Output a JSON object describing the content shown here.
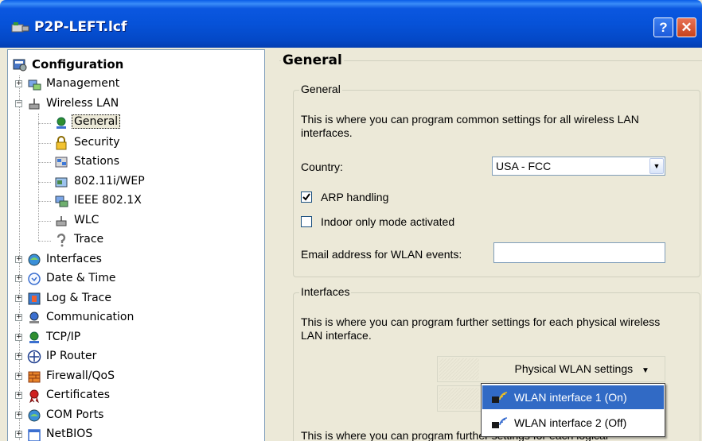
{
  "window": {
    "title": "P2P-LEFT.lcf",
    "help_label": "?",
    "close_label": "✕"
  },
  "tree": {
    "root": {
      "label": "Configuration",
      "icon": "configuration-icon"
    },
    "items": [
      {
        "label": "Management",
        "icon": "management-icon",
        "expander": "+"
      },
      {
        "label": "Wireless LAN",
        "icon": "wireless-lan-icon",
        "expander": "−"
      },
      {
        "label": "General",
        "icon": "general-icon",
        "selected": true
      },
      {
        "label": "Security",
        "icon": "lock-icon"
      },
      {
        "label": "Stations",
        "icon": "stations-icon"
      },
      {
        "label": "802.11i/WEP",
        "icon": "wep-icon"
      },
      {
        "label": "IEEE 802.1X",
        "icon": "ieee-icon"
      },
      {
        "label": "WLC",
        "icon": "wlc-icon"
      },
      {
        "label": "Trace",
        "icon": "trace-icon"
      },
      {
        "label": "Interfaces",
        "icon": "interfaces-icon",
        "expander": "+"
      },
      {
        "label": "Date & Time",
        "icon": "clock-icon",
        "expander": "+"
      },
      {
        "label": "Log & Trace",
        "icon": "log-icon",
        "expander": "+"
      },
      {
        "label": "Communication",
        "icon": "communication-icon",
        "expander": "+"
      },
      {
        "label": "TCP/IP",
        "icon": "tcpip-icon",
        "expander": "+"
      },
      {
        "label": "IP Router",
        "icon": "router-icon",
        "expander": "+"
      },
      {
        "label": "Firewall/QoS",
        "icon": "firewall-icon",
        "expander": "+"
      },
      {
        "label": "Certificates",
        "icon": "certificate-icon",
        "expander": "+"
      },
      {
        "label": "COM Ports",
        "icon": "com-icon",
        "expander": "+"
      },
      {
        "label": "NetBIOS",
        "icon": "netbios-icon",
        "expander": "+"
      }
    ]
  },
  "main": {
    "title": "General",
    "general_group": {
      "legend": "General",
      "description": "This is where you can program common settings for all wireless LAN interfaces.",
      "country_label": "Country:",
      "country_value": "USA - FCC",
      "arp_label": "ARP handling",
      "arp_checked": true,
      "indoor_label": "Indoor only mode activated",
      "indoor_checked": false,
      "email_label": "Email address for WLAN events:",
      "email_value": ""
    },
    "interfaces_group": {
      "legend": "Interfaces",
      "description": "This is where you can program further settings for each physical wireless LAN interface.",
      "button_label": "Physical WLAN settings",
      "button_arrow": "▼",
      "popup_items": [
        "WLAN interface 1 (On)",
        "WLAN interface 2 (Off)"
      ],
      "logical_description_partial": "This is where you can program further settings for each logical"
    }
  },
  "colors": {
    "titlebar": "#0652D8",
    "selection": "#316AC5",
    "window_bg": "#ECE9D8"
  }
}
